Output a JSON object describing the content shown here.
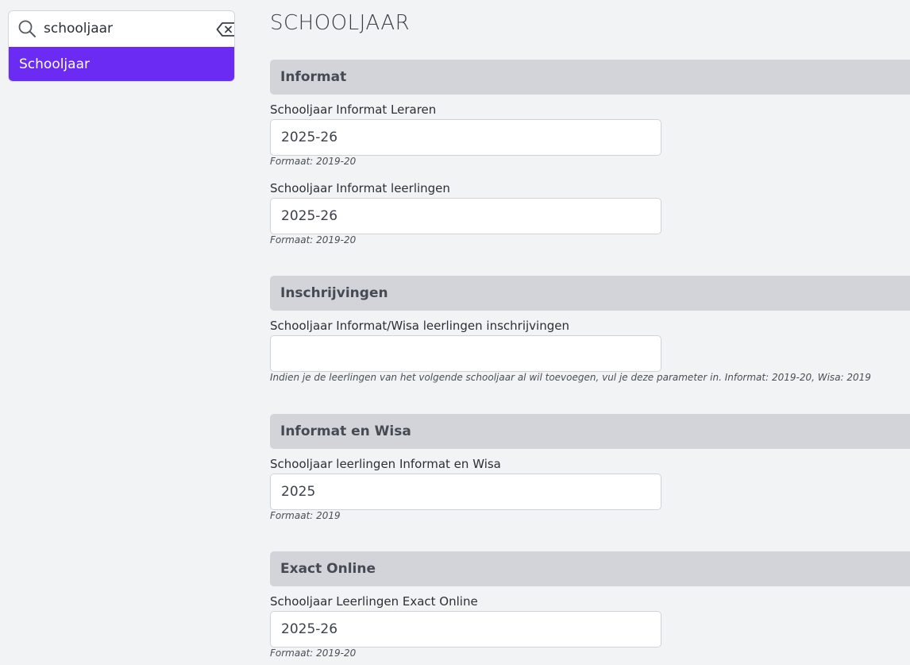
{
  "search": {
    "value": "schooljaar",
    "placeholder": "",
    "results": [
      "Schooljaar"
    ]
  },
  "page": {
    "title": "SCHOOLJAAR"
  },
  "sections": [
    {
      "title": "Informat",
      "fields": [
        {
          "label": "Schooljaar Informat Leraren",
          "value": "2025-26",
          "help": "Formaat: 2019-20"
        },
        {
          "label": "Schooljaar Informat leerlingen",
          "value": "2025-26",
          "help": "Formaat: 2019-20"
        }
      ]
    },
    {
      "title": "Inschrijvingen",
      "fields": [
        {
          "label": "Schooljaar Informat/Wisa leerlingen inschrijvingen",
          "value": "",
          "help": "Indien je de leerlingen van het volgende schooljaar al wil toevoegen, vul je deze parameter in. Informat: 2019-20, Wisa: 2019"
        }
      ]
    },
    {
      "title": "Informat en Wisa",
      "fields": [
        {
          "label": "Schooljaar leerlingen Informat en Wisa",
          "value": "2025",
          "help": "Formaat: 2019"
        }
      ]
    },
    {
      "title": "Exact Online",
      "fields": [
        {
          "label": "Schooljaar Leerlingen Exact Online",
          "value": "2025-26",
          "help": "Formaat: 2019-20"
        }
      ]
    }
  ],
  "colors": {
    "accent": "#6b2bf2",
    "background": "#f2f3f5",
    "section_header": "#d2d4da"
  },
  "icons": {
    "search": "search-icon",
    "clear": "backspace-clear-icon"
  }
}
